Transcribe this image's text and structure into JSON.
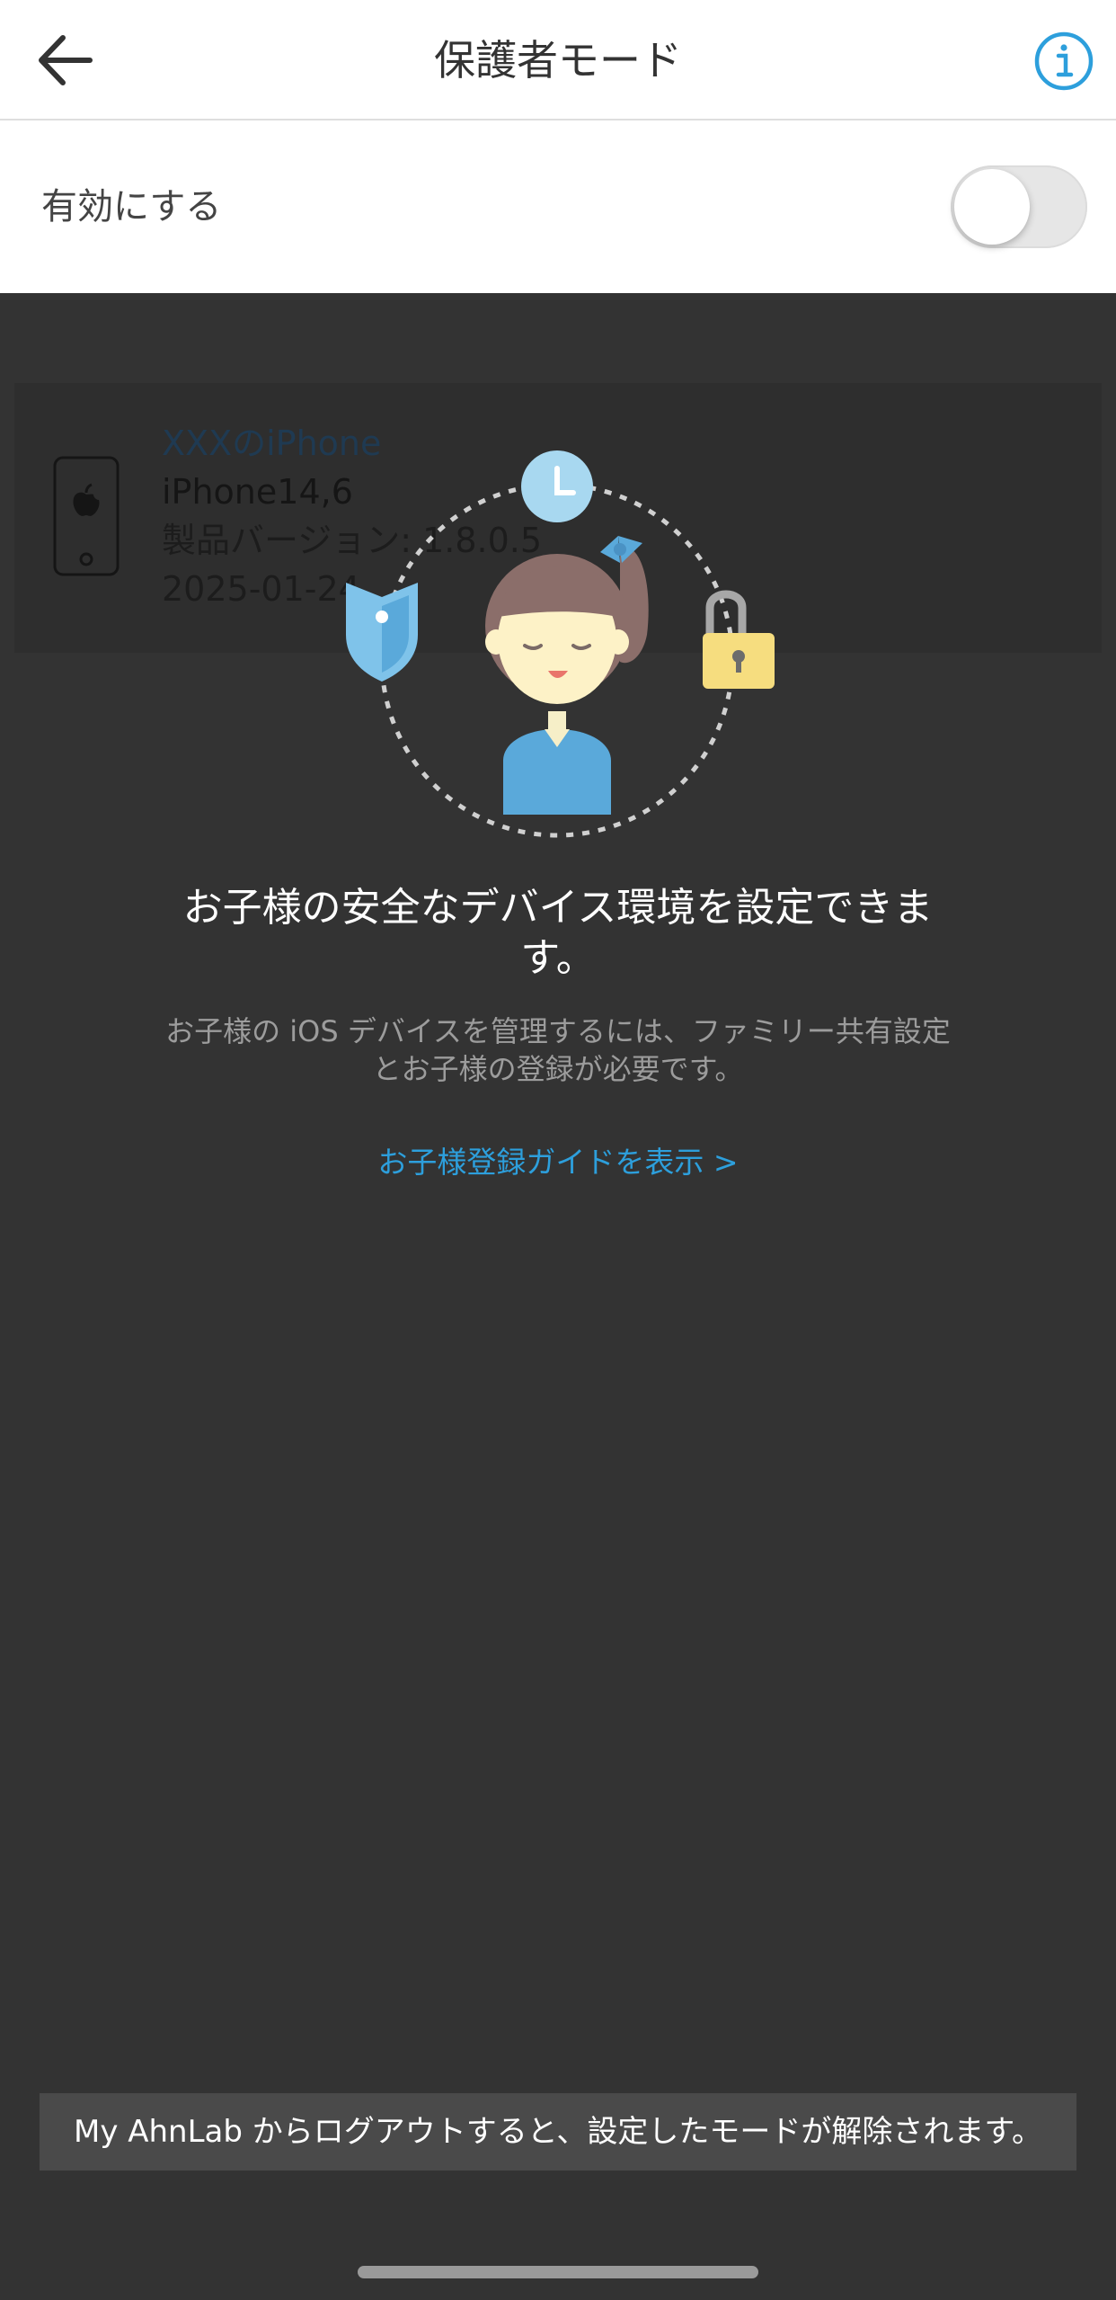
{
  "header": {
    "title": "保護者モード",
    "back_icon": "arrow-left-icon",
    "info_icon": "info-icon"
  },
  "enable": {
    "label": "有効にする",
    "toggle_on": false
  },
  "device": {
    "name": "XXXのiPhone",
    "model": "iPhone14,6",
    "version": "製品バージョン: 1.8.0.5",
    "date": "2025-01-24",
    "icon": "apple-icon"
  },
  "intro": {
    "headline": "お子様の安全なデバイス環境を設定できます。",
    "subtext": "お子様の iOS デバイスを管理するには、ファミリー共有設定とお子様の登録が必要です。",
    "guide_link": "お子様登録ガイドを表示 >"
  },
  "toast": {
    "message": "My AhnLab からログアウトすると、設定したモードが解除されます。"
  },
  "colors": {
    "accent": "#2d9fdc",
    "overlay": "#333333"
  }
}
